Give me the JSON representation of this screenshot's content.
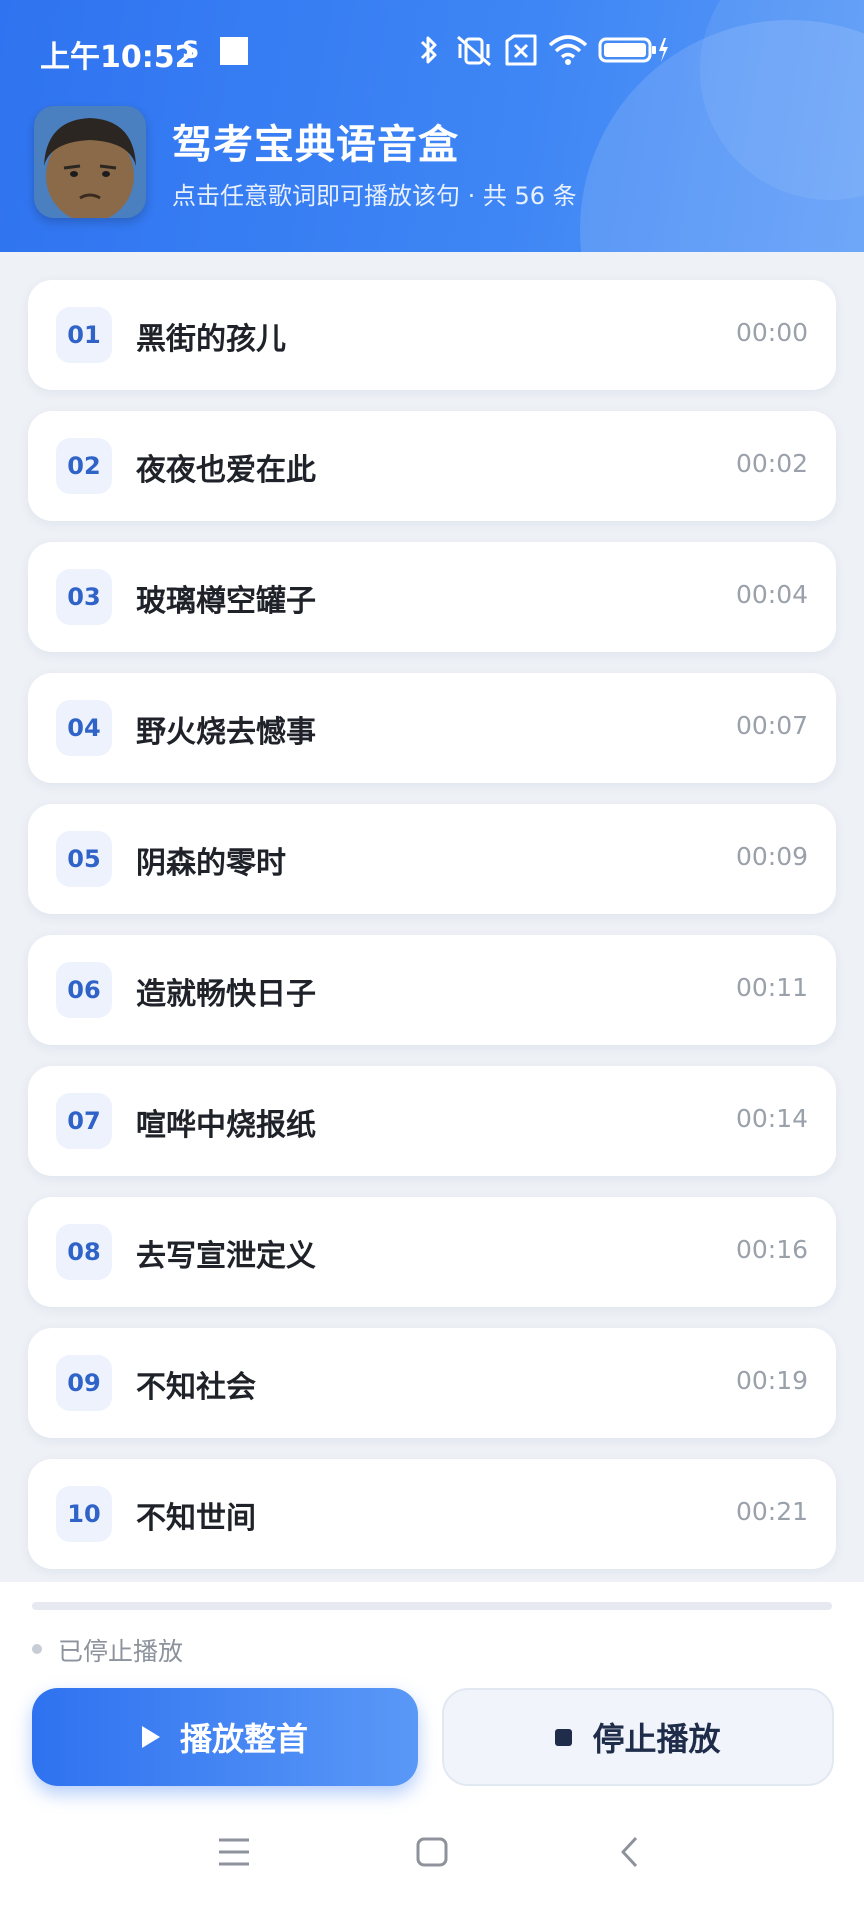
{
  "status_bar": {
    "time": "上午10:52",
    "sim_icon": "sim-icon",
    "icons": [
      "bluetooth-icon",
      "vibrate-off-icon",
      "no-sim-icon",
      "wifi-icon",
      "battery-charging-icon"
    ]
  },
  "app": {
    "title": "驾考宝典语音盒",
    "subtitle": "点击任意歌词即可播放该句 · 共 56 条",
    "avatar": "avatar-face"
  },
  "lyrics": [
    {
      "num": "01",
      "text": "黑街的孩儿",
      "time": "00:00"
    },
    {
      "num": "02",
      "text": "夜夜也爱在此",
      "time": "00:02"
    },
    {
      "num": "03",
      "text": "玻璃樽空罐子",
      "time": "00:04"
    },
    {
      "num": "04",
      "text": "野火烧去憾事",
      "time": "00:07"
    },
    {
      "num": "05",
      "text": "阴森的零时",
      "time": "00:09"
    },
    {
      "num": "06",
      "text": "造就畅快日子",
      "time": "00:11"
    },
    {
      "num": "07",
      "text": "喧哗中烧报纸",
      "time": "00:14"
    },
    {
      "num": "08",
      "text": "去写宣泄定义",
      "time": "00:16"
    },
    {
      "num": "09",
      "text": "不知社会",
      "time": "00:19"
    },
    {
      "num": "10",
      "text": "不知世间",
      "time": "00:21"
    }
  ],
  "player": {
    "progress": 0,
    "state": "已停止播放",
    "play_label": "播放整首",
    "stop_label": "停止播放"
  },
  "nav": {
    "icons": [
      "menu-icon",
      "home-icon",
      "back-icon"
    ]
  },
  "colors": {
    "accent": "#2f73f0",
    "num_bg": "#edf2fd",
    "num_text": "#2f63c8"
  }
}
